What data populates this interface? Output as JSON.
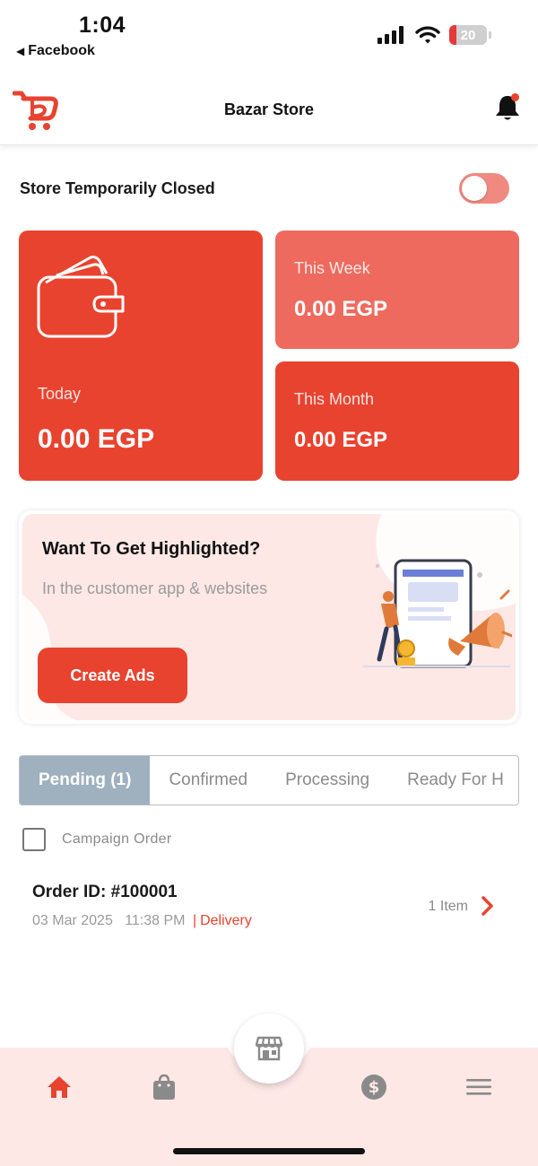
{
  "status_bar": {
    "time": "1:04",
    "back_app": "Facebook",
    "battery_level": "20",
    "battery_fraction": 0.2,
    "battery_color": "#e53a3a"
  },
  "header": {
    "title": "Bazar Store",
    "has_notification": true
  },
  "store_status": {
    "label": "Store Temporarily Closed",
    "toggle_on": false
  },
  "earnings": {
    "today": {
      "label": "Today",
      "value": "0.00 EGP"
    },
    "week": {
      "label": "This Week",
      "value": "0.00 EGP"
    },
    "month": {
      "label": "This Month",
      "value": "0.00 EGP"
    }
  },
  "promo": {
    "title": "Want To Get Highlighted?",
    "subtitle": "In the customer app & websites",
    "button_label": "Create Ads"
  },
  "order_tabs": {
    "items": [
      "Pending (1)",
      "Confirmed",
      "Processing",
      "Ready For H"
    ],
    "active_index": 0
  },
  "filters": {
    "campaign_label": "Campaign Order",
    "campaign_checked": false
  },
  "orders": [
    {
      "id_label": "Order ID: #100001",
      "date": "03 Mar 2025",
      "time": "11:38 PM",
      "separator": "|",
      "type": "Delivery",
      "item_count": "1 Item"
    }
  ],
  "bottom_nav": {
    "items": [
      "home-icon",
      "bag-icon",
      "store-icon",
      "dollar-icon",
      "menu-icon"
    ],
    "active": "home-icon"
  },
  "colors": {
    "primary": "#e8432f",
    "primary_light": "#ee6a5e",
    "promo_bg": "#fde8e6",
    "tab_active": "#9fb0bf"
  }
}
